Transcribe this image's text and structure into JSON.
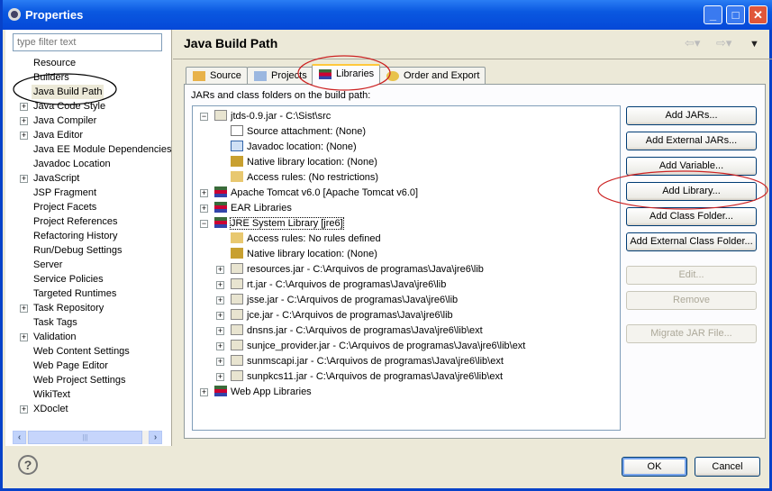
{
  "window": {
    "title": "Properties"
  },
  "sidebar": {
    "filter_placeholder": "type filter text",
    "items": [
      {
        "label": "Resource",
        "expandable": false
      },
      {
        "label": "Builders",
        "expandable": false
      },
      {
        "label": "Java Build Path",
        "expandable": false,
        "selected": true
      },
      {
        "label": "Java Code Style",
        "expandable": true
      },
      {
        "label": "Java Compiler",
        "expandable": true
      },
      {
        "label": "Java Editor",
        "expandable": true
      },
      {
        "label": "Java EE Module Dependencies",
        "expandable": false
      },
      {
        "label": "Javadoc Location",
        "expandable": false
      },
      {
        "label": "JavaScript",
        "expandable": true
      },
      {
        "label": "JSP Fragment",
        "expandable": false
      },
      {
        "label": "Project Facets",
        "expandable": false
      },
      {
        "label": "Project References",
        "expandable": false
      },
      {
        "label": "Refactoring History",
        "expandable": false
      },
      {
        "label": "Run/Debug Settings",
        "expandable": false
      },
      {
        "label": "Server",
        "expandable": false
      },
      {
        "label": "Service Policies",
        "expandable": false
      },
      {
        "label": "Targeted Runtimes",
        "expandable": false
      },
      {
        "label": "Task Repository",
        "expandable": true
      },
      {
        "label": "Task Tags",
        "expandable": false
      },
      {
        "label": "Validation",
        "expandable": true
      },
      {
        "label": "Web Content Settings",
        "expandable": false
      },
      {
        "label": "Web Page Editor",
        "expandable": false
      },
      {
        "label": "Web Project Settings",
        "expandable": false
      },
      {
        "label": "WikiText",
        "expandable": false
      },
      {
        "label": "XDoclet",
        "expandable": true
      }
    ]
  },
  "page": {
    "title": "Java Build Path",
    "tabs": [
      "Source",
      "Projects",
      "Libraries",
      "Order and Export"
    ],
    "active_tab": "Libraries",
    "list_label": "JARs and class folders on the build path:"
  },
  "tree": [
    {
      "label": "jtds-0.9.jar - C:\\Sist\\src",
      "level": 0,
      "toggle": "-",
      "icon": "jar"
    },
    {
      "label": "Source attachment: (None)",
      "level": 1,
      "icon": "source"
    },
    {
      "label": "Javadoc location: (None)",
      "level": 1,
      "icon": "javadoc"
    },
    {
      "label": "Native library location: (None)",
      "level": 1,
      "icon": "native"
    },
    {
      "label": "Access rules: (No restrictions)",
      "level": 1,
      "icon": "access"
    },
    {
      "label": "Apache Tomcat v6.0 [Apache Tomcat v6.0]",
      "level": 0,
      "toggle": "+",
      "icon": "library"
    },
    {
      "label": "EAR Libraries",
      "level": 0,
      "toggle": "+",
      "icon": "library"
    },
    {
      "label": "JRE System Library [jre6]",
      "level": 0,
      "toggle": "-",
      "icon": "library",
      "focused": true
    },
    {
      "label": "Access rules: No rules defined",
      "level": 1,
      "icon": "access"
    },
    {
      "label": "Native library location: (None)",
      "level": 1,
      "icon": "native"
    },
    {
      "label": "resources.jar - C:\\Arquivos de programas\\Java\\jre6\\lib",
      "level": 1,
      "toggle": "+",
      "icon": "jar"
    },
    {
      "label": "rt.jar - C:\\Arquivos de programas\\Java\\jre6\\lib",
      "level": 1,
      "toggle": "+",
      "icon": "jar"
    },
    {
      "label": "jsse.jar - C:\\Arquivos de programas\\Java\\jre6\\lib",
      "level": 1,
      "toggle": "+",
      "icon": "jar"
    },
    {
      "label": "jce.jar - C:\\Arquivos de programas\\Java\\jre6\\lib",
      "level": 1,
      "toggle": "+",
      "icon": "jar"
    },
    {
      "label": "dnsns.jar - C:\\Arquivos de programas\\Java\\jre6\\lib\\ext",
      "level": 1,
      "toggle": "+",
      "icon": "jar"
    },
    {
      "label": "sunjce_provider.jar - C:\\Arquivos de programas\\Java\\jre6\\lib\\ext",
      "level": 1,
      "toggle": "+",
      "icon": "jar"
    },
    {
      "label": "sunmscapi.jar - C:\\Arquivos de programas\\Java\\jre6\\lib\\ext",
      "level": 1,
      "toggle": "+",
      "icon": "jar"
    },
    {
      "label": "sunpkcs11.jar - C:\\Arquivos de programas\\Java\\jre6\\lib\\ext",
      "level": 1,
      "toggle": "+",
      "icon": "jar"
    },
    {
      "label": "Web App Libraries",
      "level": 0,
      "toggle": "+",
      "icon": "library"
    }
  ],
  "buttons": [
    {
      "label": "Add JARs...",
      "enabled": true
    },
    {
      "label": "Add External JARs...",
      "enabled": true
    },
    {
      "label": "Add Variable...",
      "enabled": true
    },
    {
      "label": "Add Library...",
      "enabled": true
    },
    {
      "label": "Add Class Folder...",
      "enabled": true
    },
    {
      "label": "Add External Class Folder...",
      "enabled": true
    },
    {
      "label": "Edit...",
      "enabled": false
    },
    {
      "label": "Remove",
      "enabled": false
    },
    {
      "label": "Migrate JAR File...",
      "enabled": false
    }
  ],
  "footer": {
    "ok": "OK",
    "cancel": "Cancel",
    "help": "?"
  },
  "colors": {
    "annotation_red": "#cc2222",
    "annotation_black": "#000000",
    "titlebar": "#0a58e0"
  }
}
